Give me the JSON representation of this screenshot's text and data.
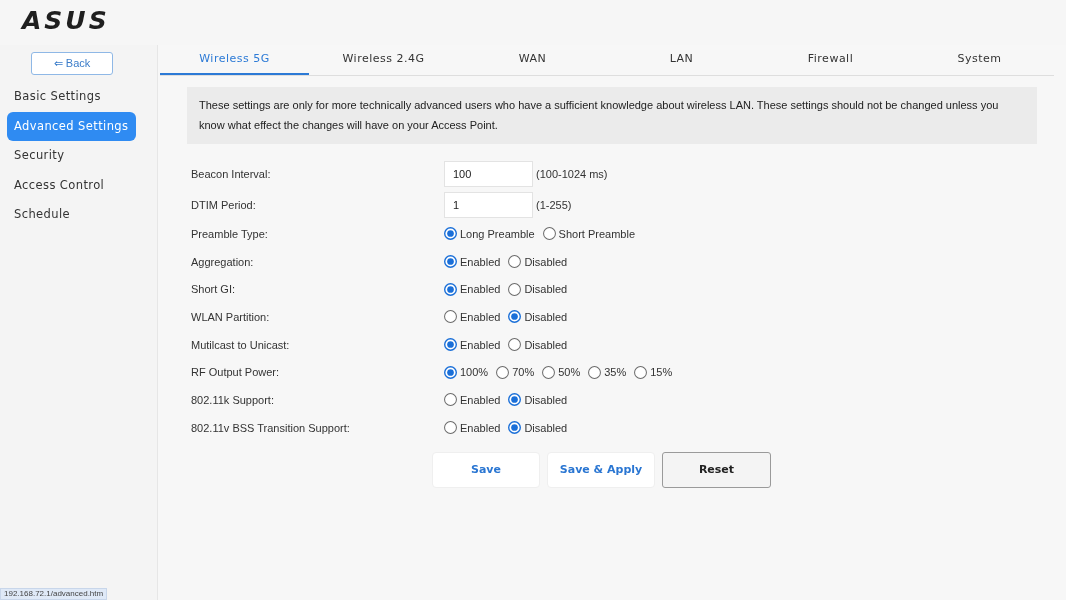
{
  "logo": "ASUS",
  "sidebar": {
    "back_button": "⇐ Back",
    "items": [
      {
        "label": "Basic Settings",
        "selected": false
      },
      {
        "label": "Advanced Settings",
        "selected": true
      },
      {
        "label": "Security",
        "selected": false
      },
      {
        "label": "Access Control",
        "selected": false
      },
      {
        "label": "Schedule",
        "selected": false
      }
    ]
  },
  "tabs": [
    {
      "label": "Wireless 5G",
      "selected": true
    },
    {
      "label": "Wireless 2.4G",
      "selected": false
    },
    {
      "label": "WAN",
      "selected": false
    },
    {
      "label": "LAN",
      "selected": false
    },
    {
      "label": "Firewall",
      "selected": false
    },
    {
      "label": "System",
      "selected": false
    }
  ],
  "notice": "These settings are only for more technically advanced users who have a sufficient knowledge about wireless LAN. These settings should not be changed unless you know what effect the changes will have on your Access Point.",
  "settings": [
    {
      "label": "Beacon Interval:",
      "kind": "input",
      "value": "100",
      "hint": "(100-1024 ms)"
    },
    {
      "label": "DTIM Period:",
      "kind": "input",
      "value": "1",
      "hint": "(1-255)"
    },
    {
      "label": "Preamble Type:",
      "kind": "radio",
      "options": [
        {
          "label": "Long Preamble",
          "selected": true
        },
        {
          "label": "Short Preamble",
          "selected": false
        }
      ]
    },
    {
      "label": "Aggregation:",
      "kind": "radio",
      "options": [
        {
          "label": "Enabled",
          "selected": true
        },
        {
          "label": "Disabled",
          "selected": false
        }
      ]
    },
    {
      "label": "Short GI:",
      "kind": "radio",
      "options": [
        {
          "label": "Enabled",
          "selected": true
        },
        {
          "label": "Disabled",
          "selected": false
        }
      ]
    },
    {
      "label": "WLAN Partition:",
      "kind": "radio",
      "options": [
        {
          "label": "Enabled",
          "selected": false
        },
        {
          "label": "Disabled",
          "selected": true
        }
      ]
    },
    {
      "label": "Mutilcast to Unicast:",
      "kind": "radio",
      "options": [
        {
          "label": "Enabled",
          "selected": true
        },
        {
          "label": "Disabled",
          "selected": false
        }
      ]
    },
    {
      "label": "RF Output Power:",
      "kind": "radio",
      "options": [
        {
          "label": "100%",
          "selected": true
        },
        {
          "label": "70%",
          "selected": false
        },
        {
          "label": "50%",
          "selected": false
        },
        {
          "label": "35%",
          "selected": false
        },
        {
          "label": "15%",
          "selected": false
        }
      ]
    },
    {
      "label": "802.11k Support:",
      "kind": "radio",
      "options": [
        {
          "label": "Enabled",
          "selected": false
        },
        {
          "label": "Disabled",
          "selected": true
        }
      ]
    },
    {
      "label": "802.11v BSS Transition Support:",
      "kind": "radio",
      "options": [
        {
          "label": "Enabled",
          "selected": false
        },
        {
          "label": "Disabled",
          "selected": true
        }
      ]
    }
  ],
  "buttons": [
    {
      "label": "Save",
      "kind": "primary"
    },
    {
      "label": "Save & Apply",
      "kind": "primary"
    },
    {
      "label": "Reset",
      "kind": "default"
    }
  ],
  "status_bar": {
    "url": "192.168.72.1/advanced.htm"
  }
}
